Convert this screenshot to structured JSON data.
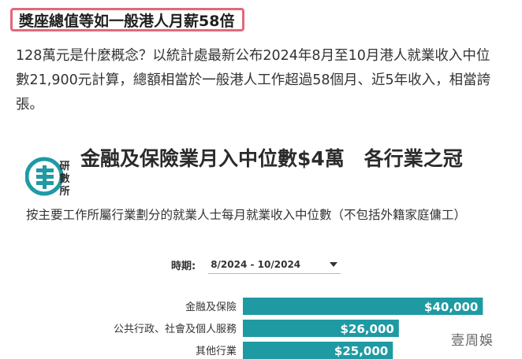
{
  "headline": "獎座總值等如一般港人月薪58倍",
  "article": {
    "paragraph": "128萬元是什麼概念？以統計處最新公布2024年8月至10月港人就業收入中位數21,900元計算，總額相當於一般港人工作超過58個月、近5年收入，相當誇張。"
  },
  "logo": {
    "name": "research-data-logo-icon",
    "text": [
      "研",
      "數",
      "所"
    ],
    "color": "#1f9aa3"
  },
  "chart_data": {
    "type": "bar",
    "orientation": "horizontal",
    "title": "金融及保險業月入中位數$4萬　各行業之冠",
    "subtitle": "按主要工作所屬行業劃分的就業人士每月就業收入中位數（不包括外籍家庭傭工）",
    "period_label": "時期:",
    "period_value": "8/2024 - 10/2024",
    "categories": [
      "金融及保險",
      "公共行政、社會及個人服務",
      "其他行業"
    ],
    "values": [
      40000,
      26000,
      25000
    ],
    "value_labels": [
      "$40,000",
      "$26,000",
      "$25,000"
    ],
    "xlim": [
      0,
      41000
    ],
    "bar_color": "#1f9aa3",
    "grid": false
  },
  "watermark": "壹周娛"
}
